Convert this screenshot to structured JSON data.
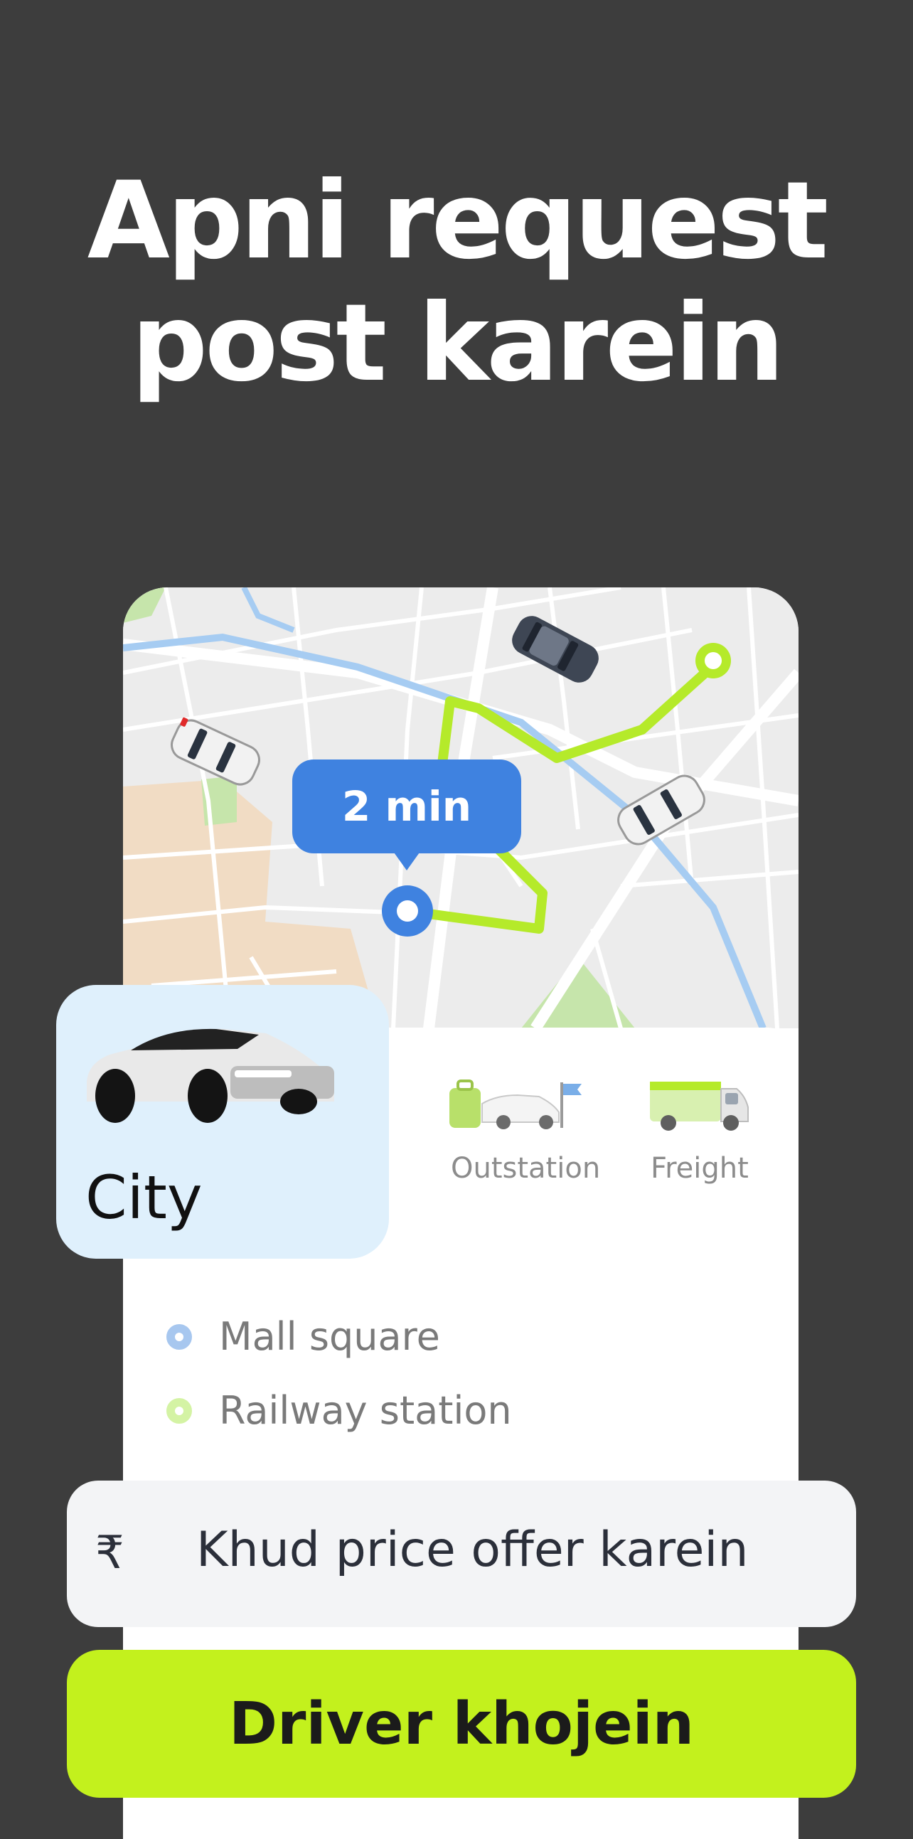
{
  "headline": {
    "line1": "Apni request",
    "line2": "post karein"
  },
  "map": {
    "eta_label": "2 min"
  },
  "categories": {
    "selected": {
      "label": "City"
    },
    "others": [
      {
        "label": "Outstation",
        "icon": "outstation-icon"
      },
      {
        "label": "Freight",
        "icon": "freight-truck-icon"
      }
    ]
  },
  "route": {
    "pickup": {
      "label": "Mall square",
      "color": "#a7c7ef"
    },
    "destination": {
      "label": "Railway station",
      "color": "#d4f3a4"
    }
  },
  "price": {
    "currency_symbol": "₹",
    "placeholder": "Khud price offer karein"
  },
  "cta": {
    "label": "Driver khojein"
  },
  "colors": {
    "accent": "#c3f11d",
    "eta_blue": "#3f82e0",
    "route_green": "#b5ea2a"
  }
}
